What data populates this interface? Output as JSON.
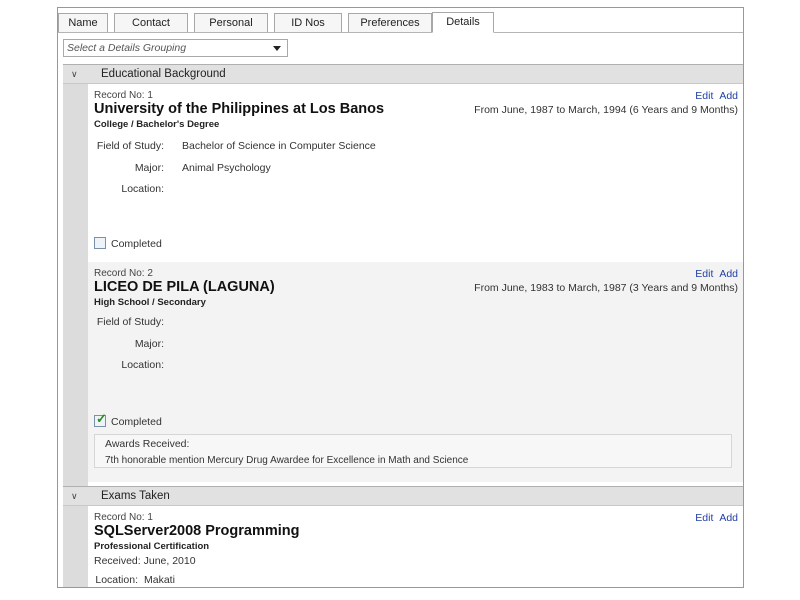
{
  "tabs": [
    {
      "label": "Name"
    },
    {
      "label": "Contact"
    },
    {
      "label": "Personal"
    },
    {
      "label": "ID Nos"
    },
    {
      "label": "Preferences"
    },
    {
      "label": "Details"
    }
  ],
  "active_tab": "Details",
  "grouping": {
    "placeholder": "Select a Details Grouping"
  },
  "groups": {
    "education": {
      "title": "Educational Background",
      "records": [
        {
          "record_no": "Record No: 1",
          "title": "University of the Philippines at Los Banos",
          "subtitle": "College / Bachelor's Degree",
          "dates": "From June, 1987 to March, 1994 (6 Years and 9 Months)",
          "field_of_study_label": "Field of Study:",
          "field_of_study": "Bachelor of Science in Computer Science",
          "major_label": "Major:",
          "major": "Animal Psychology",
          "location_label": "Location:",
          "location": "",
          "completed_label": "Completed",
          "completed": false
        },
        {
          "record_no": "Record No: 2",
          "title": "LICEO DE PILA (LAGUNA)",
          "subtitle": "High School / Secondary",
          "dates": "From June, 1983 to March, 1987 (3 Years and 9 Months)",
          "field_of_study_label": "Field of Study:",
          "field_of_study": "",
          "major_label": "Major:",
          "major": "",
          "location_label": "Location:",
          "location": "",
          "completed_label": "Completed",
          "completed": true,
          "awards_label": "Awards Received:",
          "awards": "7th honorable mention Mercury Drug Awardee for Excellence in Math and Science"
        }
      ]
    },
    "exams": {
      "title": "Exams Taken",
      "records": [
        {
          "record_no": "Record No: 1",
          "title": "SQLServer2008 Programming",
          "subtitle": "Professional Certification",
          "received": "Received: June, 2010",
          "location_label": "Location:",
          "location": "Makati"
        }
      ]
    }
  },
  "actions": {
    "edit": "Edit",
    "add": "Add"
  },
  "colors": {
    "accent_border": "#d9825b",
    "link": "#1f3fa6",
    "check": "#2e8b20"
  }
}
